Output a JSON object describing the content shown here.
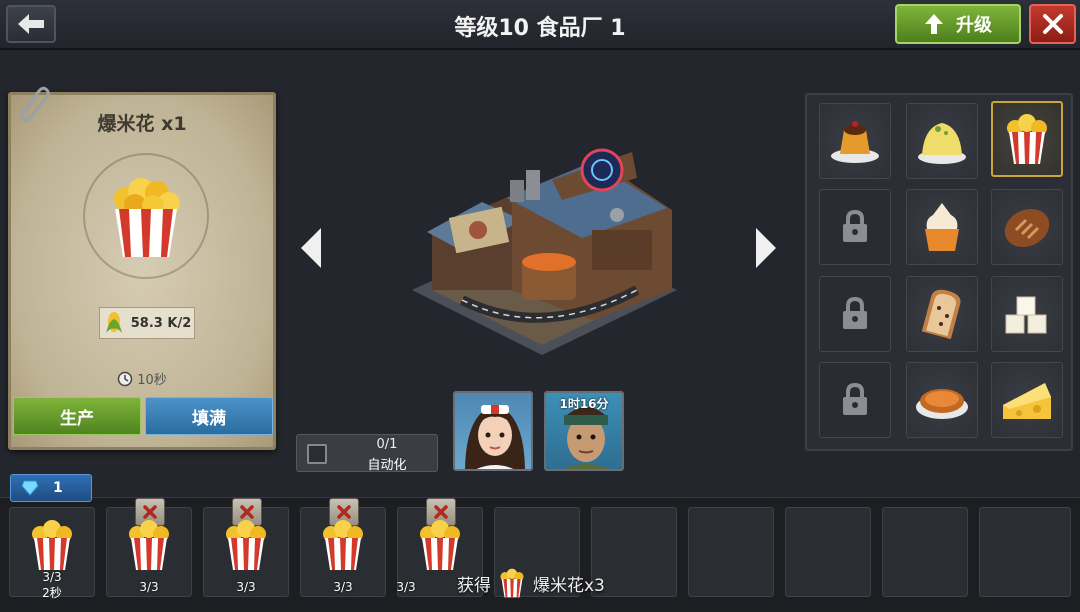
{
  "header": {
    "title": "等级10 食品厂 1",
    "upgrade_label": "升级",
    "back_icon": "back-arrow-icon",
    "close_icon": "close-icon"
  },
  "product_card": {
    "title": "爆米花 x1",
    "cost": "58.3 K/2",
    "time": "10秒",
    "produce_label": "生产",
    "fill_label": "填满"
  },
  "automation": {
    "count": "0/1",
    "label": "自动化"
  },
  "workers": [
    {
      "name": "worker-female",
      "timer": ""
    },
    {
      "name": "worker-male",
      "timer": "1时16分"
    }
  ],
  "recipes": [
    {
      "name": "pudding",
      "locked": false,
      "selected": false
    },
    {
      "name": "mashed-potato",
      "locked": false,
      "selected": false
    },
    {
      "name": "popcorn",
      "locked": false,
      "selected": true
    },
    {
      "name": "locked",
      "locked": true,
      "selected": false
    },
    {
      "name": "cupcake",
      "locked": false,
      "selected": false
    },
    {
      "name": "bread-loaf",
      "locked": false,
      "selected": false
    },
    {
      "name": "locked",
      "locked": true,
      "selected": false
    },
    {
      "name": "raisin-bread",
      "locked": false,
      "selected": false
    },
    {
      "name": "sugar-cubes",
      "locked": false,
      "selected": false
    },
    {
      "name": "locked",
      "locked": true,
      "selected": false
    },
    {
      "name": "pie",
      "locked": false,
      "selected": false
    },
    {
      "name": "cheese",
      "locked": false,
      "selected": false
    }
  ],
  "gems": {
    "count": "1"
  },
  "queue": [
    {
      "count": "3/3",
      "time": "2秒",
      "removable": false
    },
    {
      "count": "3/3",
      "time": "",
      "removable": true
    },
    {
      "count": "3/3",
      "time": "",
      "removable": true
    },
    {
      "count": "3/3",
      "time": "",
      "removable": true
    },
    {
      "count": "3/3",
      "time": "",
      "removable": true
    },
    {
      "count": "",
      "time": "",
      "removable": false
    },
    {
      "count": "",
      "time": "",
      "removable": false
    },
    {
      "count": "",
      "time": "",
      "removable": false
    },
    {
      "count": "",
      "time": "",
      "removable": false
    },
    {
      "count": "",
      "time": "",
      "removable": false
    },
    {
      "count": "",
      "time": "",
      "removable": false
    }
  ],
  "reward": {
    "prefix": "获得",
    "item": "爆米花x3"
  },
  "colors": {
    "accent_green": "#6aa030",
    "accent_blue": "#3a82bb",
    "danger_red": "#b02a1e",
    "selected_gold": "#c9a53a"
  }
}
